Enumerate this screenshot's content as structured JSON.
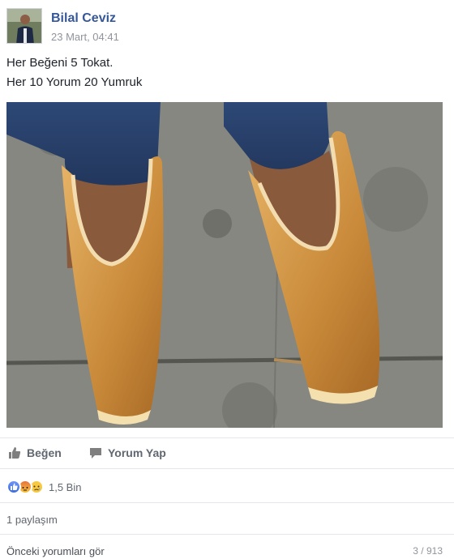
{
  "post": {
    "author": "Bilal Ceviz",
    "timestamp": "23 Mart, 04:41",
    "text_lines": [
      "Her Beğeni 5 Tokat.",
      "Her 10 Yorum 20 Yumruk"
    ]
  },
  "actions": {
    "like_label": "Beğen",
    "comment_label": "Yorum Yap"
  },
  "reactions": {
    "types": [
      "like-icon",
      "angry-icon",
      "sad-icon"
    ],
    "count": "1,5 Bin"
  },
  "shares": "1 paylaşım",
  "comments": {
    "previous_label": "Önceki yorumları gör",
    "counter": "3 / 913"
  },
  "colors": {
    "link": "#365899",
    "muted": "#90949c",
    "action": "#616770",
    "like_reaction": "#4b7bec"
  }
}
